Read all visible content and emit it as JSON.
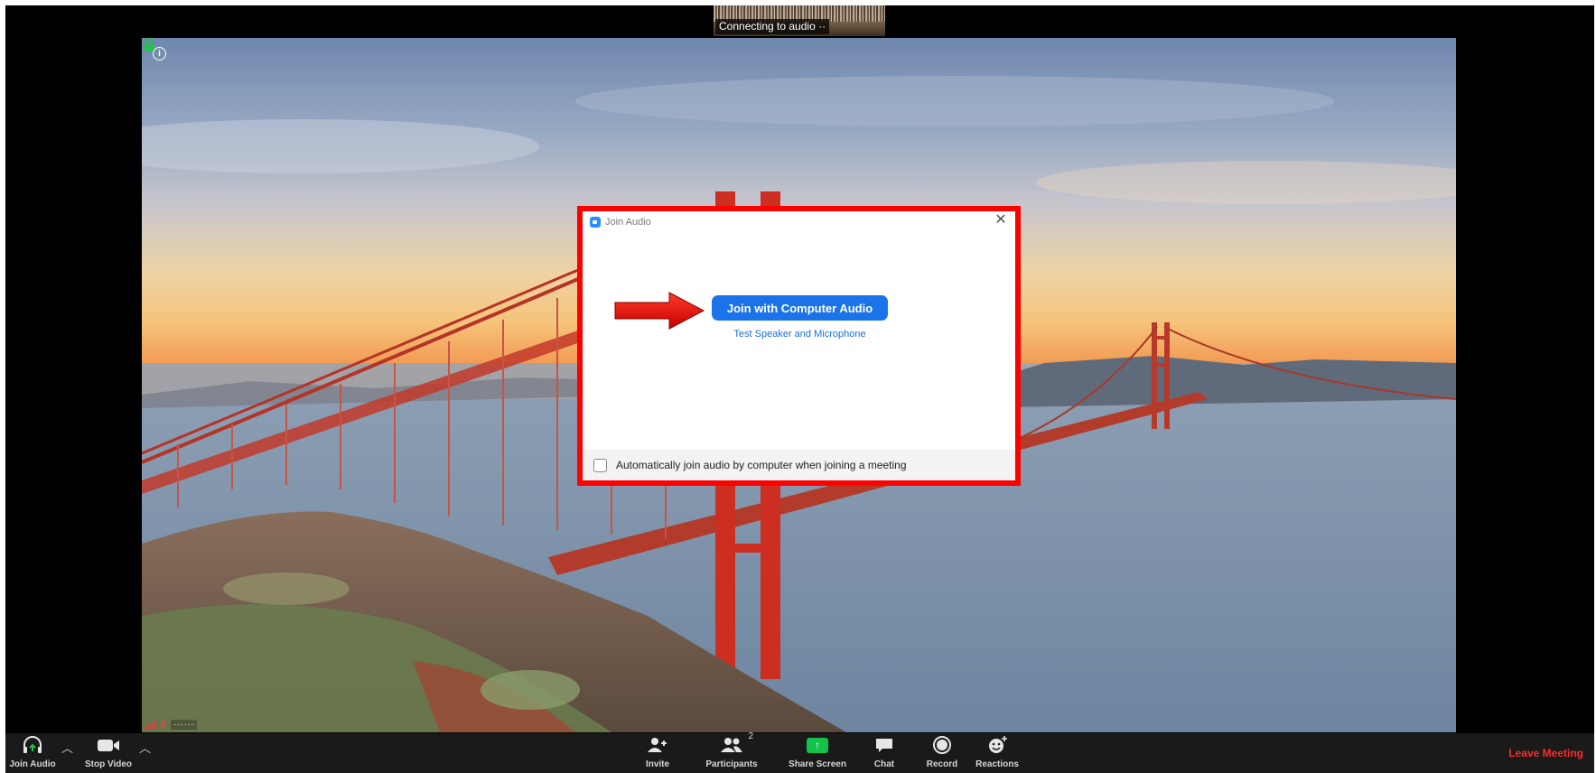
{
  "header": {
    "thumbnail_status": "Connecting to audio ··"
  },
  "video": {
    "participant_name": "······"
  },
  "dialog": {
    "title": "Join Audio",
    "close_icon": "close-icon",
    "join_button_label": "Join with Computer Audio",
    "test_link_label": "Test Speaker and Microphone",
    "auto_join_label": "Automatically join audio by computer when joining a meeting",
    "auto_join_checked": false,
    "accent_color": "#1a73e8",
    "highlight_color": "#ff0000"
  },
  "toolbar": {
    "join_audio_label": "Join Audio",
    "stop_video_label": "Stop Video",
    "invite_label": "Invite",
    "participants_label": "Participants",
    "participants_count": "2",
    "share_screen_label": "Share Screen",
    "chat_label": "Chat",
    "record_label": "Record",
    "reactions_label": "Reactions",
    "leave_label": "Leave Meeting",
    "leave_color": "#ff2a2a",
    "share_color": "#12c24b"
  }
}
